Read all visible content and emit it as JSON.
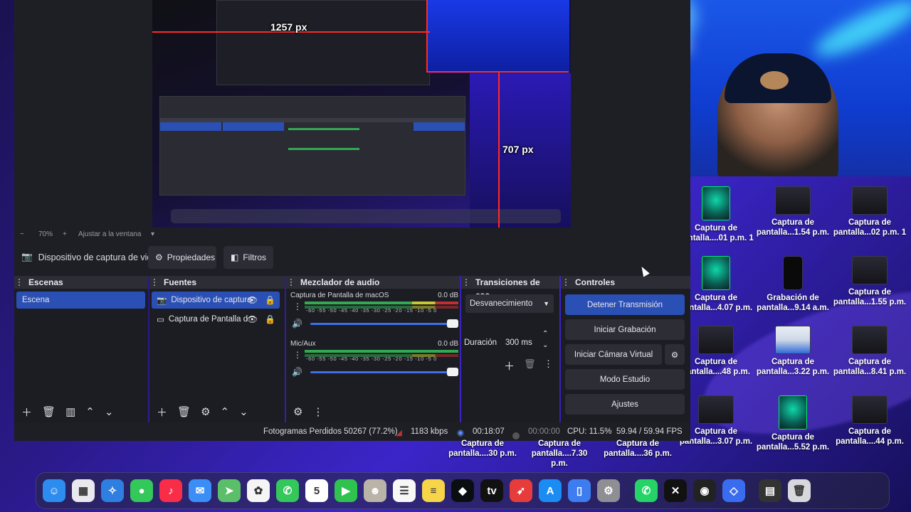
{
  "preview": {
    "measure_width_label": "1257 px",
    "measure_height_label": "707 px",
    "zoom": "70%",
    "zoom_minus": "−",
    "zoom_plus": "+",
    "fit_label": "Ajustar a la ventana"
  },
  "source_toolbar": {
    "source_name": "Dispositivo de captura de vid",
    "properties_label": "Propiedades",
    "filters_label": "Filtros"
  },
  "scenes": {
    "title": "Escenas",
    "items": [
      {
        "label": "Escena",
        "selected": true
      }
    ]
  },
  "sources": {
    "title": "Fuentes",
    "items": [
      {
        "label": "Dispositivo de captura",
        "selected": true
      },
      {
        "label": "Captura de Pantalla d",
        "selected": false
      }
    ]
  },
  "mixer": {
    "title": "Mezclador de audio",
    "scale": "-60 -55 -50 -45 -40 -35 -30 -25 -20 -15 -10 -5 0",
    "channels": [
      {
        "name": "Captura de Pantalla de macOS",
        "level": "0.0 dB"
      },
      {
        "name": "Mic/Aux",
        "level": "0.0 dB"
      }
    ]
  },
  "transitions": {
    "title": "Transiciones de esc...",
    "selected": "Desvanecimiento",
    "duration_label": "Duración",
    "duration_value": "300 ms"
  },
  "controls": {
    "title": "Controles",
    "stop_stream": "Detener Transmisión",
    "start_recording": "Iniciar Grabación",
    "start_virtual_cam": "Iniciar Cámara Virtual",
    "studio_mode": "Modo Estudio",
    "settings": "Ajustes"
  },
  "status": {
    "dropped_frames": "Fotogramas Perdidos 50267 (77.2%)",
    "bitrate": "1183 kbps",
    "stream_time": "00:18:07",
    "record_time": "00:00:00",
    "cpu": "CPU: 11.5%",
    "fps": "59.94 / 59.94 FPS"
  },
  "desktop_icons": [
    {
      "line1": "Captura de",
      "line2": "pantalla....01 p.m. 1",
      "kind": "art"
    },
    {
      "line1": "Captura de",
      "line2": "pantalla...1.54 p.m.",
      "kind": "screen"
    },
    {
      "line1": "Captura de",
      "line2": "pantalla...02 p.m. 1",
      "kind": "screen"
    },
    {
      "line1": "Captura de",
      "line2": "pantalla...4.07 p.m.",
      "kind": "art"
    },
    {
      "line1": "Grabación de",
      "line2": "pantalla...9.14 a.m.",
      "kind": "phone"
    },
    {
      "line1": "Captura de",
      "line2": "pantalla...1.55 p.m.",
      "kind": "screen"
    },
    {
      "line1": "Captura de",
      "line2": "pantalla....48 p.m.",
      "kind": "screen"
    },
    {
      "line1": "Captura de",
      "line2": "pantalla...3.22 p.m.",
      "kind": "web"
    },
    {
      "line1": "Captura de",
      "line2": "pantalla...8.41 p.m.",
      "kind": "screen"
    },
    {
      "line1": "Captura de",
      "line2": "pantalla...3.07 p.m.",
      "kind": "screen"
    },
    {
      "line1": "Captura de",
      "line2": "pantalla...5.52 p.m.",
      "kind": "art"
    },
    {
      "line1": "Captura de",
      "line2": "pantalla....44 p.m.",
      "kind": "screen"
    }
  ],
  "under_obs_labels": [
    "pantalla....30 p.m.",
    "pantalla....7.30 p.m.",
    "pantalla....36 p.m."
  ],
  "under_obs_top": [
    "Captura de",
    "Captura de",
    "Captura de"
  ],
  "dock_apps": [
    {
      "name": "finder-icon",
      "color": "#2d8cf0",
      "glyph": "☺"
    },
    {
      "name": "launchpad-icon",
      "color": "#e8e8ee",
      "glyph": "▦"
    },
    {
      "name": "safari-icon",
      "color": "#2f7fe0",
      "glyph": "✧"
    },
    {
      "name": "messages-icon",
      "color": "#34c759",
      "glyph": "●"
    },
    {
      "name": "music-icon",
      "color": "#fa2d48",
      "glyph": "♪"
    },
    {
      "name": "mail-icon",
      "color": "#3a8ef6",
      "glyph": "✉"
    },
    {
      "name": "maps-icon",
      "color": "#5bbf6a",
      "glyph": "➤"
    },
    {
      "name": "photos-icon",
      "color": "#f5f5f5",
      "glyph": "✿"
    },
    {
      "name": "phone-icon",
      "color": "#34c759",
      "glyph": "✆"
    },
    {
      "name": "calendar-icon",
      "color": "#ffffff",
      "glyph": "5"
    },
    {
      "name": "facetime-icon",
      "color": "#30c24f",
      "glyph": "▶"
    },
    {
      "name": "contacts-icon",
      "color": "#b9b3a8",
      "glyph": "☻"
    },
    {
      "name": "reminders-icon",
      "color": "#f7f7f7",
      "glyph": "☰"
    },
    {
      "name": "notes-icon",
      "color": "#f6d548",
      "glyph": "≡"
    },
    {
      "name": "binance-icon",
      "color": "#0b0e11",
      "glyph": "◆"
    },
    {
      "name": "appletv-icon",
      "color": "#111111",
      "glyph": "tv"
    },
    {
      "name": "rocket-icon",
      "color": "#e63c3c",
      "glyph": "➶"
    },
    {
      "name": "appstore-icon",
      "color": "#1b8cf2",
      "glyph": "A"
    },
    {
      "name": "files-icon",
      "color": "#3e7df0",
      "glyph": "▯"
    },
    {
      "name": "settings-icon",
      "color": "#8e8e93",
      "glyph": "⚙"
    },
    {
      "name": "whatsapp-icon",
      "color": "#25d366",
      "glyph": "✆"
    },
    {
      "name": "capcut-icon",
      "color": "#111111",
      "glyph": "✕"
    },
    {
      "name": "obs-icon",
      "color": "#222222",
      "glyph": "◉"
    },
    {
      "name": "roblox-icon",
      "color": "#3a6cf0",
      "glyph": "◇"
    },
    {
      "name": "stack-icon",
      "color": "#333333",
      "glyph": "▤"
    },
    {
      "name": "trash-icon",
      "color": "#d8d8dc",
      "glyph": "🗑"
    }
  ],
  "colors": {
    "accent": "#2a4fb5",
    "panel": "#1c1d23",
    "dock_title": "#2c2d35",
    "desktop": "#2a1a8a"
  }
}
